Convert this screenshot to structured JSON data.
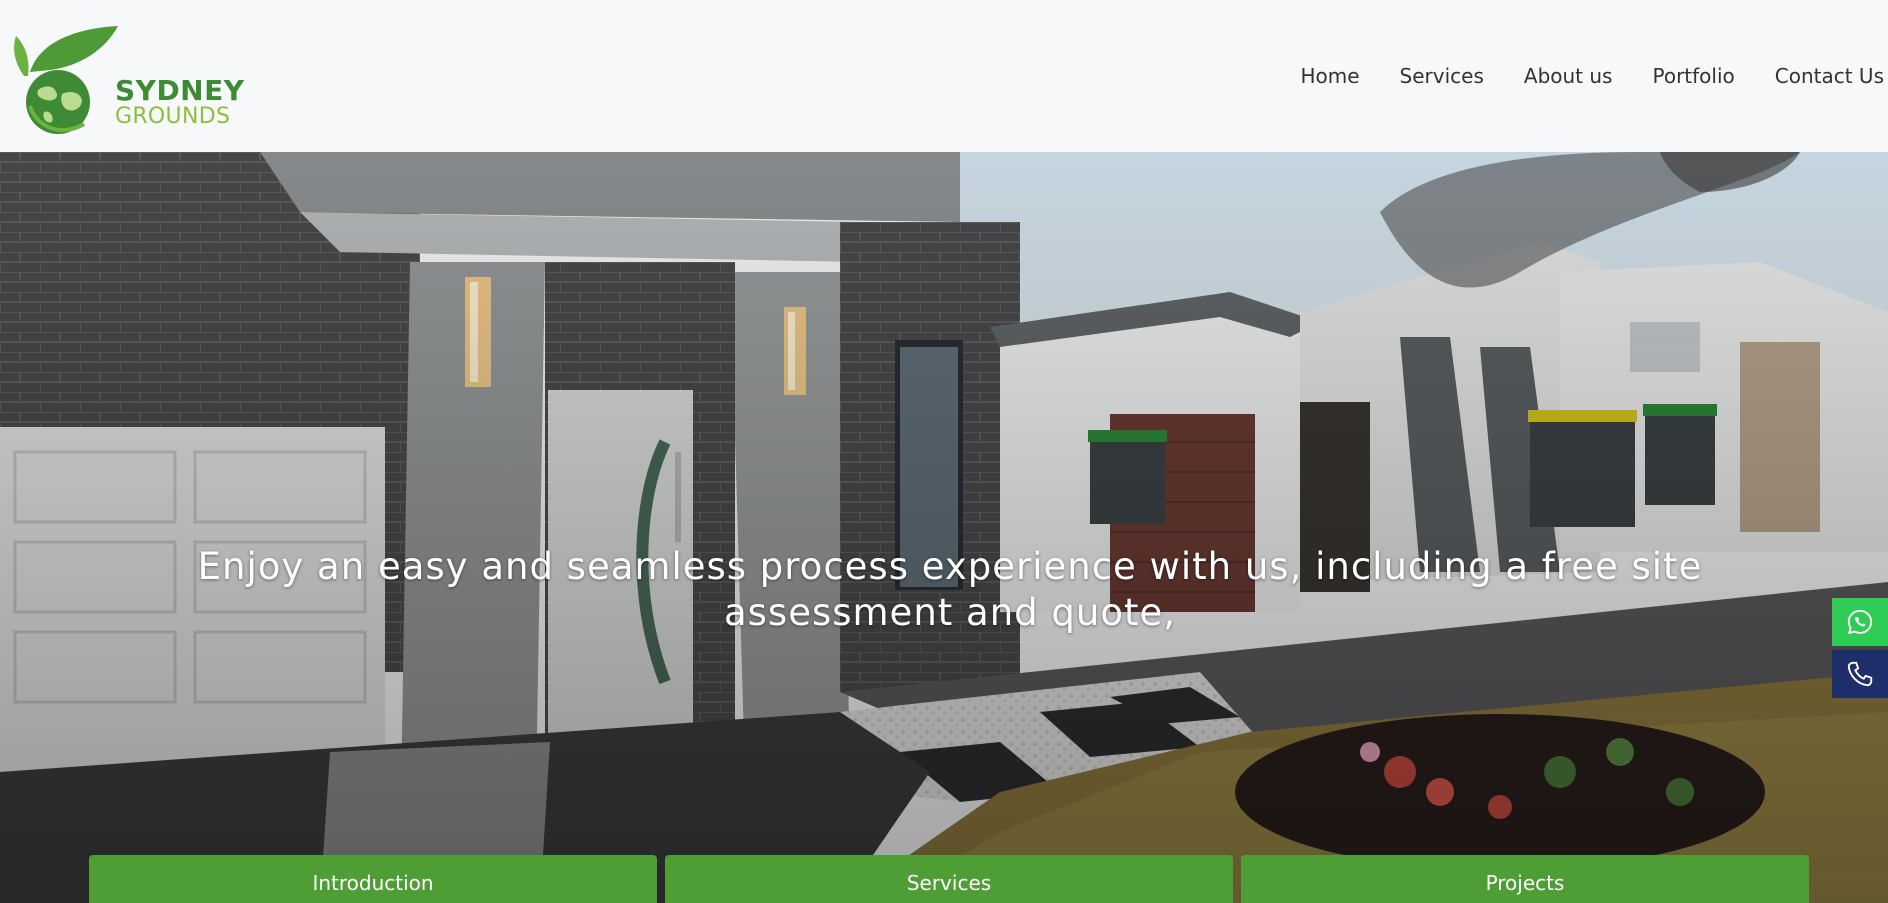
{
  "brand": {
    "name": "SYDNEY",
    "sub": "GROUNDS",
    "primary_color": "#3f8a35",
    "secondary_color": "#8cbf3f"
  },
  "nav": {
    "items": [
      {
        "label": "Home"
      },
      {
        "label": "Services"
      },
      {
        "label": "About us"
      },
      {
        "label": "Portfolio"
      },
      {
        "label": "Contact Us"
      }
    ]
  },
  "hero": {
    "headline": "Enjoy an easy and seamless process experience with us, including a free site assessment and quote,"
  },
  "side_buttons": {
    "whatsapp_icon": "whatsapp-icon",
    "phone_icon": "phone-icon",
    "whatsapp_color": "#2ecc55",
    "phone_color": "#1d2e6b"
  },
  "tabs": [
    {
      "label": "Introduction"
    },
    {
      "label": "Services"
    },
    {
      "label": "Projects"
    }
  ],
  "colors": {
    "tab_green": "#4f9e35"
  }
}
